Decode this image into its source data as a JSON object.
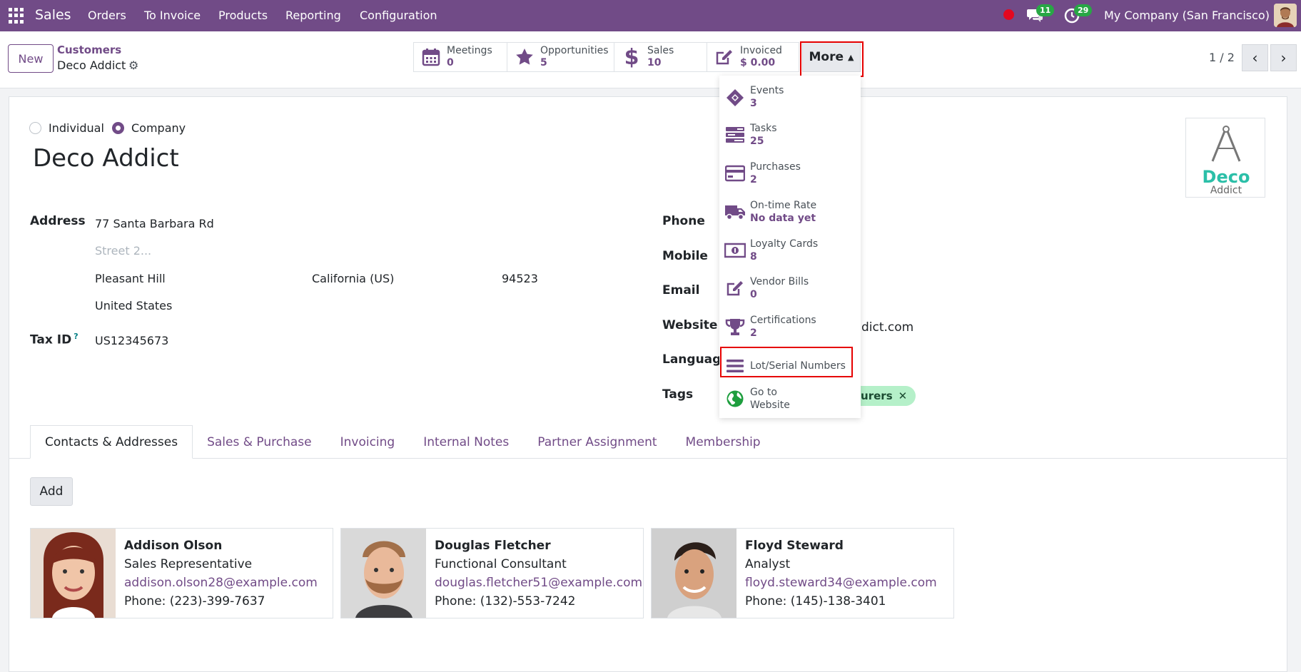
{
  "navbar": {
    "app_name": "Sales",
    "menu": [
      "Orders",
      "To Invoice",
      "Products",
      "Reporting",
      "Configuration"
    ],
    "chat_badge": "11",
    "activity_badge": "29",
    "company": "My Company (San Francisco)"
  },
  "control_panel": {
    "new_label": "New",
    "breadcrumb_parent": "Customers",
    "breadcrumb_current": "Deco Addict",
    "stats": [
      {
        "label": "Meetings",
        "value": "0",
        "icon": "calendar-icon"
      },
      {
        "label": "Opportunities",
        "value": "5",
        "icon": "star-icon"
      },
      {
        "label": "Sales",
        "value": "10",
        "icon": "dollar-icon"
      },
      {
        "label": "Invoiced",
        "value": "$ 0.00",
        "icon": "pencil-square-icon"
      }
    ],
    "more_label": "More",
    "pager": "1 / 2"
  },
  "more_menu": [
    {
      "label": "Events",
      "value": "3",
      "icon": "ticket-icon"
    },
    {
      "label": "Tasks",
      "value": "25",
      "icon": "tasks-icon"
    },
    {
      "label": "Purchases",
      "value": "2",
      "icon": "credit-card-icon"
    },
    {
      "label": "On-time Rate",
      "value": "No data yet",
      "icon": "truck-icon"
    },
    {
      "label": "Loyalty Cards",
      "value": "8",
      "icon": "money-icon"
    },
    {
      "label": "Vendor Bills",
      "value": "0",
      "icon": "pencil-square-icon"
    },
    {
      "label": "Certifications",
      "value": "2",
      "icon": "trophy-icon"
    },
    {
      "label": "Lot/Serial Numbers",
      "value": "",
      "icon": "bars-icon"
    },
    {
      "label": "Go to",
      "value": "Website",
      "icon": "globe-icon"
    }
  ],
  "form": {
    "type_individual": "Individual",
    "type_company": "Company",
    "selected_type": "Company",
    "name": "Deco Addict",
    "logo_text_main": "Deco",
    "logo_text_sub": "Addict",
    "address_label": "Address",
    "street": "77 Santa Barbara Rd",
    "street2_placeholder": "Street 2...",
    "city": "Pleasant Hill",
    "state": "California (US)",
    "zip": "94523",
    "country": "United States",
    "tax_id_label": "Tax ID",
    "tax_id_help": "?",
    "tax_id": "US12345673",
    "phone_label": "Phone",
    "mobile_label": "Mobile",
    "email_label": "Email",
    "website_label": "Website",
    "website_visible": "dict.com",
    "language_label": "Language",
    "tags_label": "Tags",
    "tag_visible": "cturers"
  },
  "tabs": [
    "Contacts & Addresses",
    "Sales & Purchase",
    "Invoicing",
    "Internal Notes",
    "Partner Assignment",
    "Membership"
  ],
  "active_tab": "Contacts & Addresses",
  "add_label": "Add",
  "contacts": [
    {
      "name": "Addison Olson",
      "function": "Sales Representative",
      "email": "addison.olson28@example.com",
      "phone": "Phone: (223)-399-7637"
    },
    {
      "name": "Douglas Fletcher",
      "function": "Functional Consultant",
      "email": "douglas.fletcher51@example.com",
      "phone": "Phone: (132)-553-7242"
    },
    {
      "name": "Floyd Steward",
      "function": "Analyst",
      "email": "floyd.steward34@example.com",
      "phone": "Phone: (145)-138-3401"
    }
  ],
  "colors": {
    "brand": "#714b87",
    "badge": "#28a745",
    "highlight": "#e60000",
    "tag_bg": "#b5f0c9"
  }
}
